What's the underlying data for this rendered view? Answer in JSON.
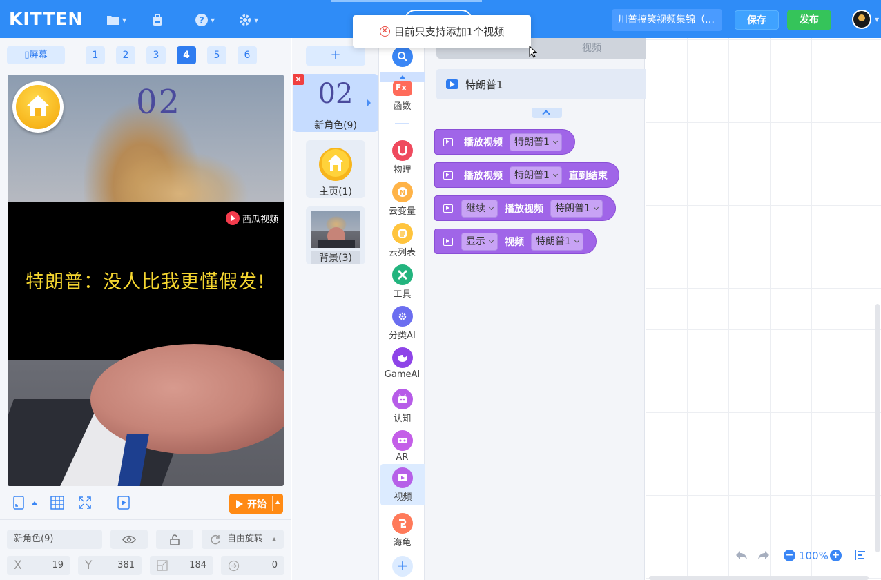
{
  "header": {
    "logo": "KITTEN",
    "project_title": "川普搞笑视频集锦（…",
    "save_label": "保存",
    "publish_label": "发布",
    "icons": [
      "folder-icon",
      "backpack-icon",
      "help-icon",
      "settings-icon"
    ]
  },
  "toast": {
    "message": "目前只支持添加1个视频"
  },
  "stage": {
    "screen_label": "屏幕",
    "screens": [
      "1",
      "2",
      "3",
      "4",
      "5",
      "6"
    ],
    "active_screen": "4",
    "overlay_number": "02",
    "watermark": "西瓜视频",
    "subtitle": "特朗普：没人比我更懂假发!",
    "start_label": "开始"
  },
  "properties": {
    "sprite_name": "新角色(9)",
    "rotation_label": "自由旋转",
    "x_label": "X",
    "x": "19",
    "y_label": "Y",
    "y": "381",
    "size": "184",
    "direction": "0"
  },
  "sprites": {
    "add_label": "+",
    "items": [
      {
        "label": "新角色(9)",
        "thumb_text": "02"
      },
      {
        "label": "主页(1)"
      },
      {
        "label": "背景(3)"
      }
    ]
  },
  "categories": [
    {
      "label": "函数",
      "icon": "function-icon",
      "color": "#ff6b5a"
    },
    {
      "label": "物理",
      "icon": "magnet-icon",
      "color": "#ef4a5e"
    },
    {
      "label": "云变量",
      "icon": "cloud-variable-icon",
      "color": "#ffb347"
    },
    {
      "label": "云列表",
      "icon": "cloud-list-icon",
      "color": "#ffc43d"
    },
    {
      "label": "工具",
      "icon": "tools-icon",
      "color": "#23b47e"
    },
    {
      "label": "分类AI",
      "icon": "classify-ai-icon",
      "color": "#6b6ef0"
    },
    {
      "label": "GameAI",
      "icon": "game-ai-icon",
      "color": "#8e44e8"
    },
    {
      "label": "认知",
      "icon": "robot-icon",
      "color": "#b75ce8"
    },
    {
      "label": "AR",
      "icon": "ar-icon",
      "color": "#c45ee8"
    },
    {
      "label": "视频",
      "icon": "video-icon",
      "color": "#b660e8"
    },
    {
      "label": "海龟",
      "icon": "turtle-icon",
      "color": "#ff7a5a"
    }
  ],
  "palette": {
    "header_label": "视频",
    "video_item": "特朗普1",
    "blocks": [
      {
        "parts": [
          "播放视频"
        ],
        "dropdown": "特朗普1"
      },
      {
        "parts": [
          "播放视频",
          "直到结束"
        ],
        "dropdown": "特朗普1"
      },
      {
        "lead_dropdown": "继续",
        "parts": [
          "播放视频"
        ],
        "dropdown": "特朗普1"
      },
      {
        "lead_dropdown": "显示",
        "parts": [
          "视频"
        ],
        "dropdown": "特朗普1"
      }
    ]
  },
  "workspace": {
    "zoom": "100%"
  }
}
